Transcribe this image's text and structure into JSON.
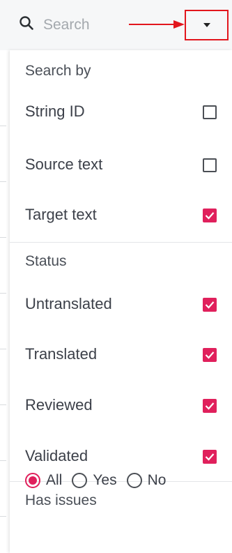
{
  "search": {
    "placeholder": "Search"
  },
  "colors": {
    "accent": "#e0205c",
    "highlight_box": "#e2161d"
  },
  "panel": {
    "search_by": {
      "title": "Search by",
      "options": [
        {
          "label": "String ID",
          "checked": false
        },
        {
          "label": "Source text",
          "checked": false
        },
        {
          "label": "Target text",
          "checked": true
        }
      ]
    },
    "status": {
      "title": "Status",
      "options": [
        {
          "label": "Untranslated",
          "checked": true
        },
        {
          "label": "Translated",
          "checked": true
        },
        {
          "label": "Reviewed",
          "checked": true
        },
        {
          "label": "Validated",
          "checked": true
        }
      ]
    },
    "has_issues": {
      "title": "Has issues",
      "options": [
        {
          "label": "All",
          "selected": true
        },
        {
          "label": "Yes",
          "selected": false
        },
        {
          "label": "No",
          "selected": false
        }
      ]
    }
  }
}
